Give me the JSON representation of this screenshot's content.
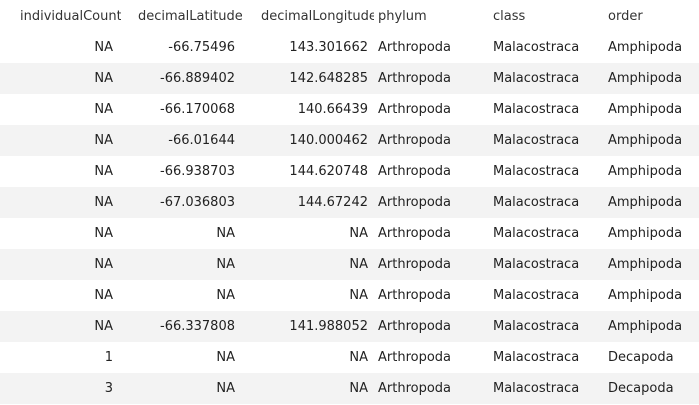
{
  "table": {
    "columns": [
      "individualCount",
      "decimalLatitude",
      "decimalLongitude",
      "phylum",
      "class",
      "order"
    ],
    "rows": [
      [
        "NA",
        "-66.75496",
        "143.301662",
        "Arthropoda",
        "Malacostraca",
        "Amphipoda"
      ],
      [
        "NA",
        "-66.889402",
        "142.648285",
        "Arthropoda",
        "Malacostraca",
        "Amphipoda"
      ],
      [
        "NA",
        "-66.170068",
        "140.66439",
        "Arthropoda",
        "Malacostraca",
        "Amphipoda"
      ],
      [
        "NA",
        "-66.01644",
        "140.000462",
        "Arthropoda",
        "Malacostraca",
        "Amphipoda"
      ],
      [
        "NA",
        "-66.938703",
        "144.620748",
        "Arthropoda",
        "Malacostraca",
        "Amphipoda"
      ],
      [
        "NA",
        "-67.036803",
        "144.67242",
        "Arthropoda",
        "Malacostraca",
        "Amphipoda"
      ],
      [
        "NA",
        "NA",
        "NA",
        "Arthropoda",
        "Malacostraca",
        "Amphipoda"
      ],
      [
        "NA",
        "NA",
        "NA",
        "Arthropoda",
        "Malacostraca",
        "Amphipoda"
      ],
      [
        "NA",
        "NA",
        "NA",
        "Arthropoda",
        "Malacostraca",
        "Amphipoda"
      ],
      [
        "NA",
        "-66.337808",
        "141.988052",
        "Arthropoda",
        "Malacostraca",
        "Amphipoda"
      ],
      [
        "1",
        "NA",
        "NA",
        "Arthropoda",
        "Malacostraca",
        "Decapoda"
      ],
      [
        "3",
        "NA",
        "NA",
        "Arthropoda",
        "Malacostraca",
        "Decapoda"
      ]
    ]
  }
}
